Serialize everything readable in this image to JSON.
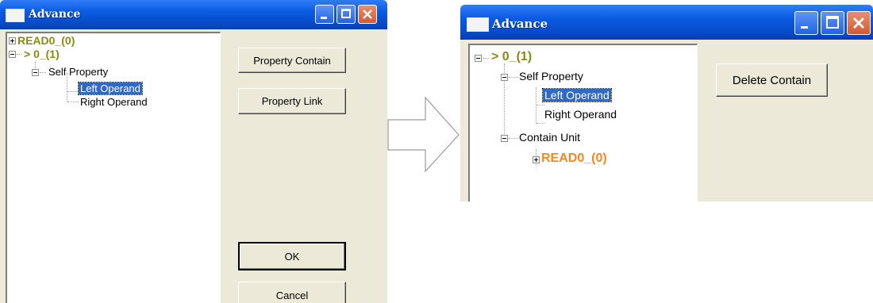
{
  "before_window": {
    "title": "Advance",
    "tree": {
      "root1_label": "READ0_(0)",
      "root2_label": "> 0_(1)",
      "self_property_label": "Self Property",
      "left_operand_label": "Left Operand",
      "right_operand_label": "Right Operand"
    },
    "buttons": {
      "property_contain": "Property Contain",
      "property_link": "Property Link",
      "ok": "OK",
      "cancel": "Cancel"
    }
  },
  "after_window": {
    "title": "Advance",
    "tree": {
      "root_label": "> 0_(1)",
      "self_property_label": "Self Property",
      "left_operand_label": "Left Operand",
      "right_operand_label": "Right Operand",
      "contain_unit_label": "Contain Unit",
      "read_child_label": "READ0_(0)"
    },
    "buttons": {
      "delete_contain": "Delete Contain"
    }
  },
  "colors": {
    "node_olive": "#8a8a10",
    "node_orange": "#f5871f",
    "selection": "#316ac5"
  }
}
